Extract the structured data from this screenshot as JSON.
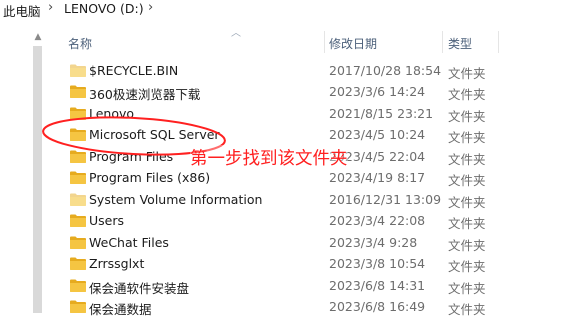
{
  "breadcrumb": {
    "items": [
      "此电脑",
      "LENOVO (D:)"
    ],
    "separator": "›"
  },
  "columns": {
    "name": "名称",
    "date": "修改日期",
    "type": "类型"
  },
  "files": [
    {
      "name": "$RECYCLE.BIN",
      "date": "2017/10/28 18:54",
      "type": "文件夹",
      "faded": true
    },
    {
      "name": "360极速浏览器下载",
      "date": "2023/3/6 14:24",
      "type": "文件夹",
      "faded": false
    },
    {
      "name": "Lenovo",
      "date": "2021/8/15 23:21",
      "type": "文件夹",
      "faded": false
    },
    {
      "name": "Microsoft SQL Server",
      "date": "2023/4/5 10:24",
      "type": "文件夹",
      "faded": false
    },
    {
      "name": "Program Files",
      "date": "2023/4/5 22:04",
      "type": "文件夹",
      "faded": false
    },
    {
      "name": "Program Files (x86)",
      "date": "2023/4/19 8:17",
      "type": "文件夹",
      "faded": false
    },
    {
      "name": "System Volume Information",
      "date": "2016/12/31 13:09",
      "type": "文件夹",
      "faded": true
    },
    {
      "name": "Users",
      "date": "2023/3/4 22:08",
      "type": "文件夹",
      "faded": false
    },
    {
      "name": "WeChat Files",
      "date": "2023/3/4 9:28",
      "type": "文件夹",
      "faded": false
    },
    {
      "name": "Zrrssglxt",
      "date": "2023/3/8 10:54",
      "type": "文件夹",
      "faded": false
    },
    {
      "name": "保会通软件安装盘",
      "date": "2023/6/8 14:31",
      "type": "文件夹",
      "faded": false
    },
    {
      "name": "保会通数据",
      "date": "2023/6/8 16:49",
      "type": "文件夹",
      "faded": false
    }
  ],
  "annotation": {
    "text": "第一步找到该文件夹",
    "color": "#ff2020"
  },
  "colors": {
    "folder_fill": "#f5c542",
    "folder_faded": "#f8dd8c",
    "folder_tab": "#e6ab1f"
  }
}
